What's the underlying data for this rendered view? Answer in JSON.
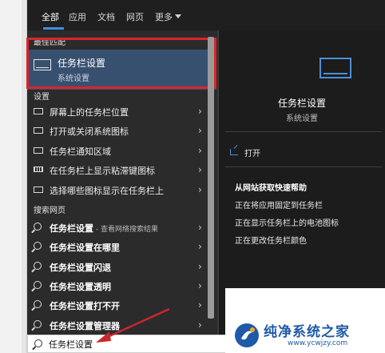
{
  "tabs": [
    "全部",
    "应用",
    "文档",
    "网页",
    "更多"
  ],
  "best_match": {
    "header": "最佳匹配",
    "title": "任务栏设置",
    "subtitle": "系统设置"
  },
  "settings": {
    "header": "设置",
    "items": [
      "屏幕上的任务栏位置",
      "打开或关闭系统图标",
      "任务栏通知区域",
      "在任务栏上显示粘滞键图标",
      "选择哪些图标显示在任务栏上"
    ]
  },
  "web": {
    "header": "搜索网页",
    "items": [
      {
        "bold": "任务栏设置",
        "rest": " - 查看网络搜索结果"
      },
      {
        "bold": "任务栏设置在哪里",
        "rest": ""
      },
      {
        "bold": "任务栏设置闪退",
        "rest": ""
      },
      {
        "bold": "任务栏设置透明",
        "rest": ""
      },
      {
        "bold": "任务栏设置打不开",
        "rest": ""
      },
      {
        "bold": "任务栏设置管理器",
        "rest": ""
      }
    ]
  },
  "preview": {
    "title": "任务栏设置",
    "subtitle": "系统设置",
    "open_label": "打开",
    "help_header": "从网站获取快速帮助",
    "help_links": [
      "正在将应用固定到任务栏",
      "正在显示任务栏上的电池图标",
      "正在更改任务栏颜色"
    ]
  },
  "search": {
    "value": "任务栏设置"
  },
  "watermark": {
    "name": "纯净系统之家",
    "url": "www.ycwjzy.com"
  },
  "colors": {
    "accent": "#3d8ee6",
    "highlight_box": "#d9252a",
    "arrow": "#c8282d",
    "selected_row": "#38506f"
  }
}
